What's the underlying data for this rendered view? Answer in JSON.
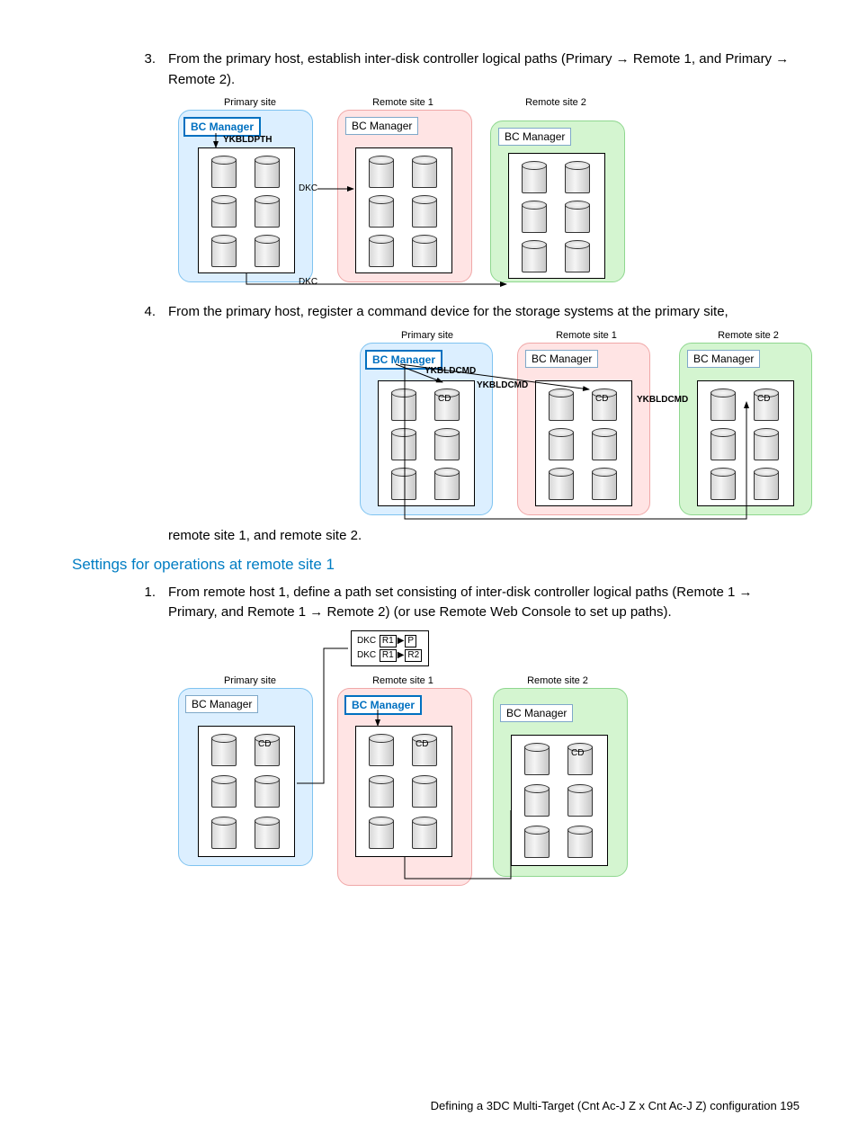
{
  "steps": {
    "s3_num": "3.",
    "s3_text": "From the primary host, establish inter-disk controller logical paths (Primary → Remote 1, and Primary → Remote 2).",
    "s4_num": "4.",
    "s4_text": "From the primary host, register a command device for the storage systems at the primary site,",
    "s4_cont": "remote site 1, and remote site 2.",
    "s1b_num": "1.",
    "s1b_text": "From remote host 1, define a path set consisting of inter-disk controller logical paths (Remote 1 → Primary, and Remote 1 → Remote 2) (or use Remote Web Console to set up paths)."
  },
  "section_heading": "Settings for operations at remote site 1",
  "labels": {
    "primary": "Primary site",
    "remote1": "Remote site 1",
    "remote2": "Remote site 2",
    "bcm": "BC Manager",
    "ykbldpth": "YKBLDPTH",
    "ykbldcmd": "YKBLDCMD",
    "dkc": "DKC",
    "cd": "CD",
    "r1": "R1",
    "p": "P",
    "r2": "R2"
  },
  "footer": "Defining a 3DC Multi-Target (Cnt Ac-J Z x Cnt Ac-J Z) configuration    195"
}
